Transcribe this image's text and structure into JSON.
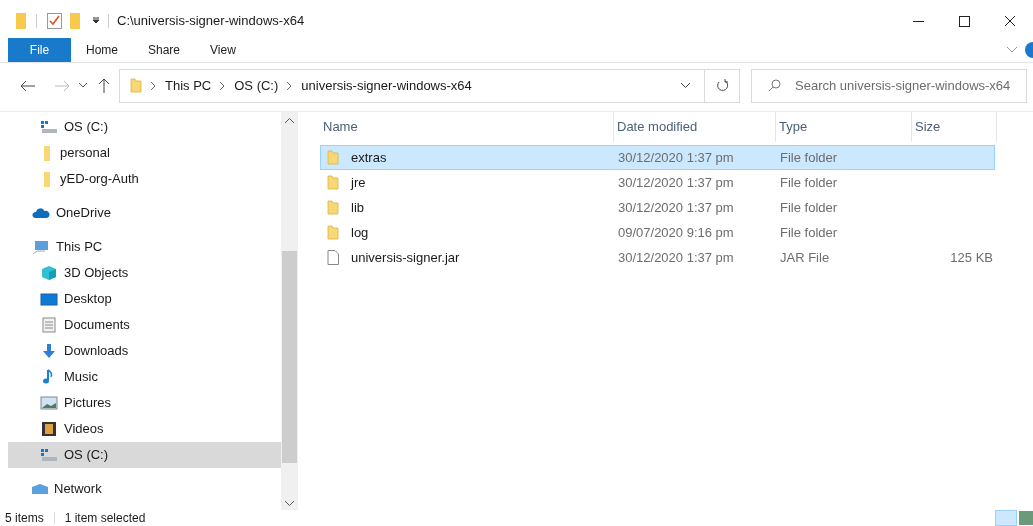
{
  "window": {
    "title": "C:\\universis-signer-windows-x64"
  },
  "ribbon_tabs": [
    {
      "label": "File",
      "selected": true
    },
    {
      "label": "Home",
      "selected": false
    },
    {
      "label": "Share",
      "selected": false
    },
    {
      "label": "View",
      "selected": false
    }
  ],
  "address_bar": {
    "crumbs": [
      "This PC",
      "OS (C:)",
      "universis-signer-windows-x64"
    ]
  },
  "search": {
    "placeholder": "Search universis-signer-windows-x64"
  },
  "nav_pane": {
    "pinned_items": [
      {
        "label": "OS (C:)",
        "kind": "drive",
        "selected": false
      },
      {
        "label": "personal",
        "kind": "folder",
        "selected": false
      },
      {
        "label": "yED-org-Auth",
        "kind": "folder",
        "selected": false
      }
    ],
    "items": [
      {
        "label": "OneDrive",
        "kind": "cloud",
        "selected": false
      },
      {
        "label": "This PC",
        "kind": "pc",
        "selected": false,
        "children": [
          {
            "label": "3D Objects",
            "kind": "objects",
            "selected": false
          },
          {
            "label": "Desktop",
            "kind": "desktop",
            "selected": false
          },
          {
            "label": "Documents",
            "kind": "documents",
            "selected": false
          },
          {
            "label": "Downloads",
            "kind": "downloads",
            "selected": false
          },
          {
            "label": "Music",
            "kind": "music",
            "selected": false
          },
          {
            "label": "Pictures",
            "kind": "pictures",
            "selected": false
          },
          {
            "label": "Videos",
            "kind": "videos",
            "selected": false
          },
          {
            "label": "OS (C:)",
            "kind": "drive",
            "selected": true
          }
        ]
      },
      {
        "label": "Network",
        "kind": "network",
        "selected": false
      }
    ]
  },
  "table": {
    "columns": [
      "Name",
      "Date modified",
      "Type",
      "Size"
    ],
    "rows": [
      {
        "name": "extras",
        "kind": "folder",
        "date": "30/12/2020 1:37 pm",
        "type": "File folder",
        "selected": true
      },
      {
        "name": "jre",
        "kind": "folder",
        "date": "30/12/2020 1:37 pm",
        "type": "File folder",
        "selected": false
      },
      {
        "name": "lib",
        "kind": "folder",
        "date": "30/12/2020 1:37 pm",
        "type": "File folder",
        "selected": false
      },
      {
        "name": "log",
        "kind": "folder",
        "date": "09/07/2020 9:16 pm",
        "type": "File folder",
        "selected": false
      },
      {
        "name": "universis-signer.jar",
        "kind": "file",
        "date": "30/12/2020 1:37 pm",
        "type": "JAR File",
        "size": "125 KB",
        "selected": false
      }
    ]
  },
  "status_bar": {
    "item_count": "5 items",
    "selection": "1 item selected"
  }
}
